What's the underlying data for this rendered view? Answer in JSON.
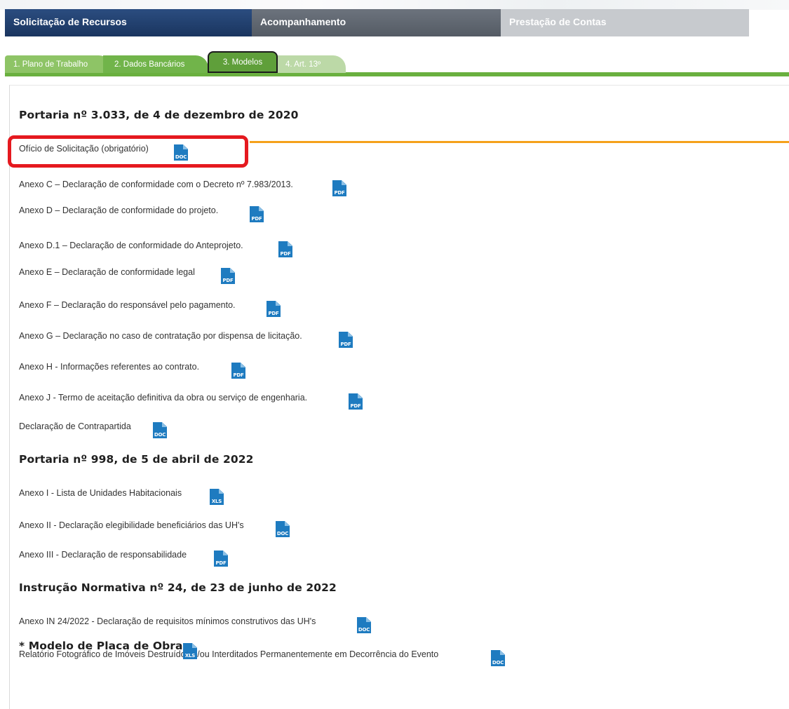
{
  "main_tabs": [
    "Solicitação de Recursos",
    "Acompanhamento",
    "Prestação de Contas"
  ],
  "sub_tabs": [
    "1. Plano de Trabalho",
    "2. Dados Bancários",
    "3. Modelos",
    "4. Art. 13º"
  ],
  "sections": [
    {
      "heading": "Portaria nº 3.033, de 4 de dezembro de 2020",
      "items": [
        {
          "label": "Ofício de Solicitação (obrigatório)",
          "file_type": "DOC"
        },
        {
          "label": "Anexo C – Declaração de conformidade com o Decreto nº 7.983/2013.",
          "file_type": "PDF"
        },
        {
          "label": "Anexo D – Declaração de conformidade do projeto.",
          "file_type": "PDF"
        },
        {
          "label": "Anexo D.1 – Declaração de conformidade do Anteprojeto.",
          "file_type": "PDF"
        },
        {
          "label": "Anexo E – Declaração de conformidade legal",
          "file_type": "PDF"
        },
        {
          "label": "Anexo F – Declaração do responsável pelo pagamento.",
          "file_type": "PDF"
        },
        {
          "label": "Anexo G – Declaração no caso de contratação por dispensa de licitação.",
          "file_type": "PDF"
        },
        {
          "label": "Anexo H - Informações referentes ao contrato.",
          "file_type": "PDF"
        },
        {
          "label": "Anexo J - Termo de aceitação definitiva da obra ou serviço de engenharia.",
          "file_type": "PDF"
        },
        {
          "label": "Declaração de Contrapartida",
          "file_type": "DOC"
        }
      ]
    },
    {
      "heading": "Portaria nº 998, de 5 de abril de 2022",
      "items": [
        {
          "label": "Anexo I - Lista de Unidades Habitacionais",
          "file_type": "XLS"
        },
        {
          "label": "Anexo II - Declaração elegibilidade beneficiários das UH's",
          "file_type": "DOC"
        },
        {
          "label": "Anexo III - Declaração de responsabilidade",
          "file_type": "PDF"
        }
      ]
    },
    {
      "heading": "Instrução Normativa nº 24, de 23 de junho de 2022",
      "items": [
        {
          "label": "Anexo IN 24/2022 - Declaração de requisitos mínimos construtivos das UH's",
          "file_type": "DOC"
        },
        {
          "label": "Relatório Fotográfico de Imóveis Destruídos e/ou Interditados Permanentemente em Decorrência do Evento",
          "file_type": "DOC"
        }
      ]
    }
  ],
  "placa": {
    "heading": "* Modelo de Placa de Obra",
    "file_type": "XLS"
  },
  "colors": {
    "active_main_tab": "#1f3d6e",
    "sub_tab_active": "#5f9f3a",
    "green_rule": "#6ab03f",
    "file_icon": "#1e7bc0",
    "highlight": "#e5191f",
    "pointer_line": "#f5a11b"
  }
}
